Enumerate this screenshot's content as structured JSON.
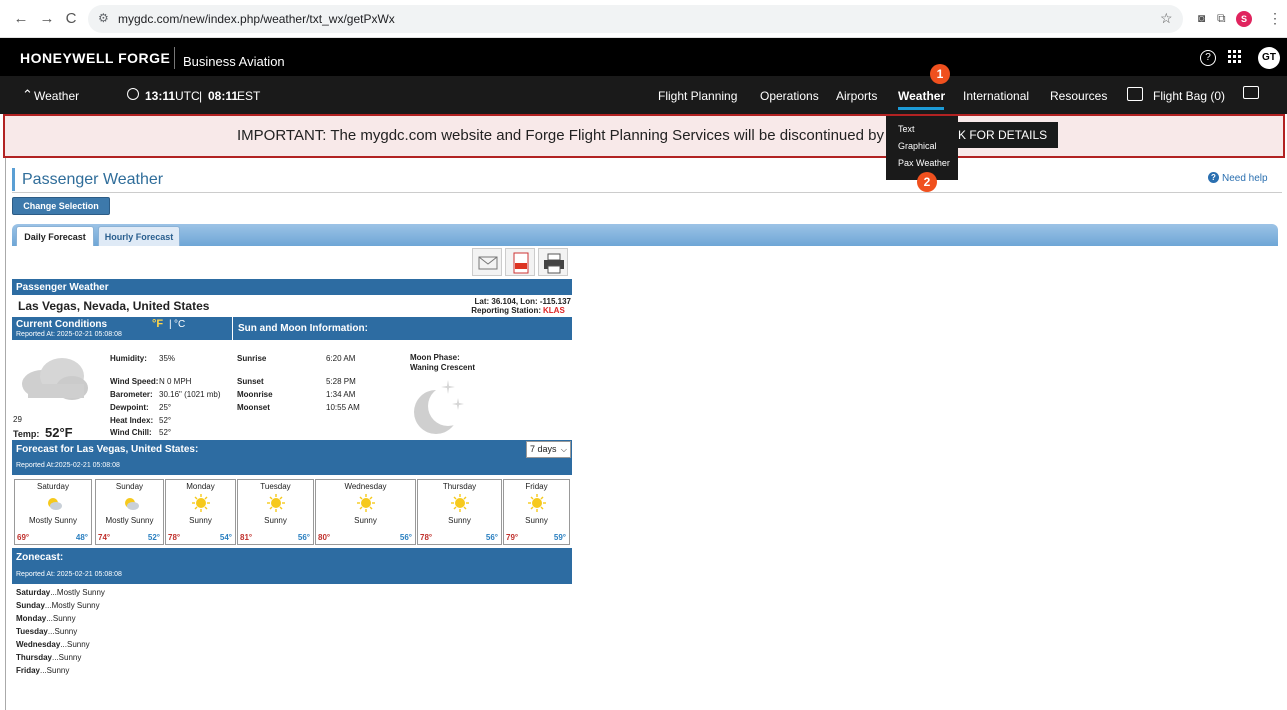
{
  "browser": {
    "back": "←",
    "forward": "→",
    "reload": "C",
    "url": "mygdc.com/new/index.php/weather/txt_wx/getPxWx",
    "profile_initial": "S",
    "menu": "⋮"
  },
  "header": {
    "brand": "HONEYWELL FORGE",
    "subtitle": "Business Aviation",
    "help": "?",
    "avatar": "GT"
  },
  "nav": {
    "section": "Weather",
    "utc_time": "13:11",
    "utc_label": "UTC",
    "sep": "|",
    "est_time": "08:11",
    "est_label": "EST",
    "items": [
      "Flight Planning",
      "Operations",
      "Airports",
      "Weather",
      "International",
      "Resources"
    ],
    "flight_bag": "Flight Bag (0)"
  },
  "banner": {
    "text": "IMPORTANT: The mygdc.com website and Forge Flight Planning Services will be discontinued by April 30, 20",
    "button": "K FOR DETAILS"
  },
  "weather_menu": {
    "options": [
      "Text",
      "Graphical",
      "Pax Weather"
    ],
    "marker_1": "1",
    "marker_2": "2"
  },
  "page": {
    "title": "Passenger Weather",
    "need_help": "Need help",
    "change_selection": "Change Selection",
    "tabs": [
      "Daily Forecast",
      "Hourly Forecast"
    ]
  },
  "report": {
    "header": "Passenger Weather",
    "location": "Las Vegas, Nevada, United States",
    "latlon": "Lat: 36.104, Lon: -115.137",
    "station_label": "Reporting Station:",
    "station": "KLAS",
    "current_title": "Current Conditions",
    "unit_f": "°F",
    "unit_sep": "|",
    "unit_c": "°C",
    "reported_at": "Reported At: 2025-02-21 05:08:08",
    "sun_moon_title": "Sun and Moon Information:",
    "humidity_label": "Humidity:",
    "humidity": "35%",
    "wind_label": "Wind Speed:",
    "wind": "N 0 MPH",
    "baro_label": "Barometer:",
    "baro": "30.16\" (1021 mb)",
    "dew_label": "Dewpoint:",
    "dew": "25°",
    "heat_label": "Heat Index:",
    "heat": "52°",
    "chill_label": "Wind Chill:",
    "chill": "52°",
    "sunrise_label": "Sunrise",
    "sunrise": "6:20 AM",
    "sunset_label": "Sunset",
    "sunset": "5:28 PM",
    "moonrise_label": "Moonrise",
    "moonrise": "1:34 AM",
    "moonset_label": "Moonset",
    "moonset": "10:55 AM",
    "moon_phase_label": "Moon Phase:",
    "moon_phase": "Waning Crescent",
    "small_num": "29",
    "temp_label": "Temp:",
    "temp": "52°F",
    "forecast_title": "Forecast for Las Vegas, United States:",
    "forecast_reported": "Reported At:2025-02-21 05:08:08",
    "days_select": "7 days",
    "forecast": [
      {
        "day": "Saturday",
        "cond": "Mostly Sunny",
        "hi": "69°",
        "lo": "48°"
      },
      {
        "day": "Sunday",
        "cond": "Mostly Sunny",
        "hi": "74°",
        "lo": "52°"
      },
      {
        "day": "Monday",
        "cond": "Sunny",
        "hi": "78°",
        "lo": "54°"
      },
      {
        "day": "Tuesday",
        "cond": "Sunny",
        "hi": "81°",
        "lo": "56°"
      },
      {
        "day": "Wednesday",
        "cond": "Sunny",
        "hi": "80°",
        "lo": "56°"
      },
      {
        "day": "Thursday",
        "cond": "Sunny",
        "hi": "78°",
        "lo": "56°"
      },
      {
        "day": "Friday",
        "cond": "Sunny",
        "hi": "79°",
        "lo": "59°"
      }
    ],
    "zonecast_title": "Zonecast:",
    "zonecast_reported": "Reported At: 2025-02-21 05:08:08",
    "zonecast": [
      {
        "day": "Saturday",
        "text": "...Mostly Sunny"
      },
      {
        "day": "Sunday",
        "text": "...Mostly Sunny"
      },
      {
        "day": "Monday",
        "text": "...Sunny"
      },
      {
        "day": "Tuesday",
        "text": "...Sunny"
      },
      {
        "day": "Wednesday",
        "text": "...Sunny"
      },
      {
        "day": "Thursday",
        "text": "...Sunny"
      },
      {
        "day": "Friday",
        "text": "...Sunny"
      }
    ]
  },
  "colors": {
    "brand_black": "#000000",
    "accent_blue": "#1c9ad6",
    "marker_orange": "#f0501e",
    "report_blue": "#2d6ca2",
    "hi_temp_red": "#c0302c",
    "lo_temp_blue": "#2a7fc0"
  }
}
